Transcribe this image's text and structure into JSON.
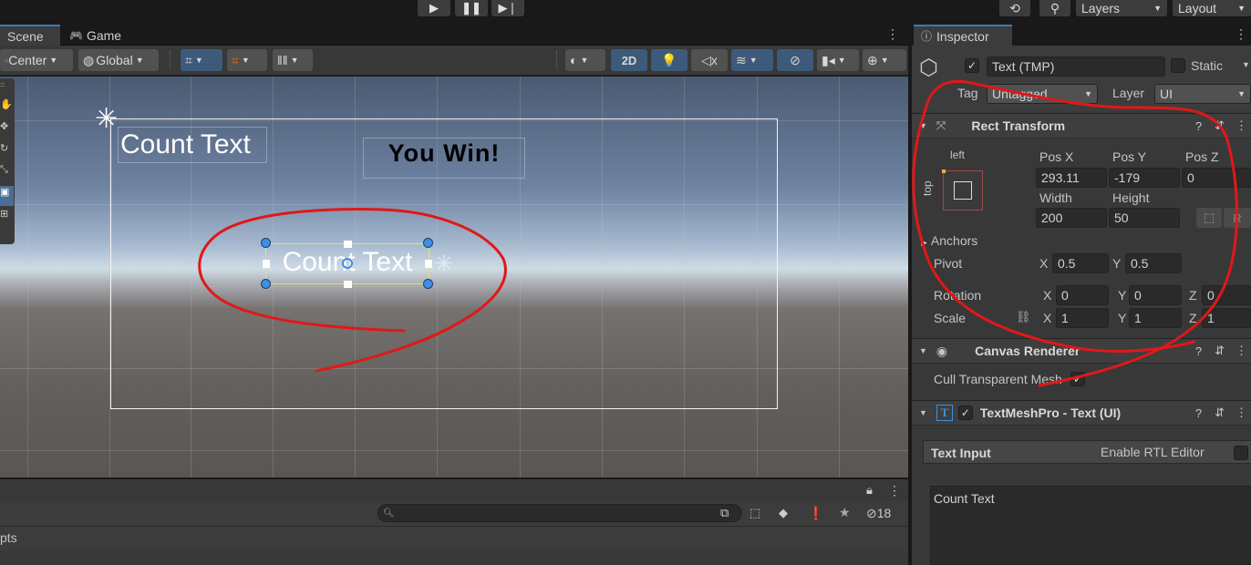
{
  "playbar": {
    "play_icon": "play-icon",
    "pause_icon": "pause-icon",
    "step_icon": "step-icon",
    "history_icon": "history-icon",
    "search_icon": "search-icon",
    "layers_label": "Layers",
    "layout_label": "Layout"
  },
  "scene_panel": {
    "tabs": [
      {
        "label": "Scene",
        "active": true
      },
      {
        "label": "Game",
        "active": false
      }
    ],
    "toolbar": {
      "pivot_label": "Center",
      "space_label": "Global",
      "mode_2d_label": "2D"
    },
    "viewport": {
      "canvas_text_1": "Count Text",
      "canvas_text_2": "You Win!",
      "selected_text": "Count Text"
    }
  },
  "bottom_panel": {
    "hidden_count": "18",
    "list_item": "pts",
    "search_placeholder": ""
  },
  "inspector": {
    "tab_label": "Inspector",
    "object_name": "Text (TMP)",
    "static_label": "Static",
    "tag_label": "Tag",
    "tag_value": "Untagged",
    "layer_label": "Layer",
    "layer_value": "UI",
    "rect_transform": {
      "title": "Rect Transform",
      "anchor_h": "left",
      "anchor_v": "top",
      "pos_x_label": "Pos X",
      "pos_y_label": "Pos Y",
      "pos_z_label": "Pos Z",
      "pos_x": "293.11",
      "pos_y": "-179",
      "pos_z": "0",
      "width_label": "Width",
      "height_label": "Height",
      "width": "200",
      "height": "50",
      "r_label": "R",
      "anchors_label": "Anchors",
      "pivot_label": "Pivot",
      "pivot_x": "0.5",
      "pivot_y": "0.5",
      "rotation_label": "Rotation",
      "rot_x": "0",
      "rot_y": "0",
      "rot_z": "0",
      "scale_label": "Scale",
      "scale_x": "1",
      "scale_y": "1",
      "scale_z": "1",
      "x_label": "X",
      "y_label": "Y",
      "z_label": "Z"
    },
    "canvas_renderer": {
      "title": "Canvas Renderer",
      "cull_label": "Cull Transparent Mesh"
    },
    "textmeshpro": {
      "title": "TextMeshPro - Text (UI)",
      "text_input_label": "Text Input",
      "rtl_label": "Enable RTL Editor",
      "text_value": "Count Text"
    }
  },
  "colors": {
    "annotation_red": "#e01818",
    "selection_yellow": "#e8e35a",
    "handle_blue": "#3f8fe0"
  }
}
